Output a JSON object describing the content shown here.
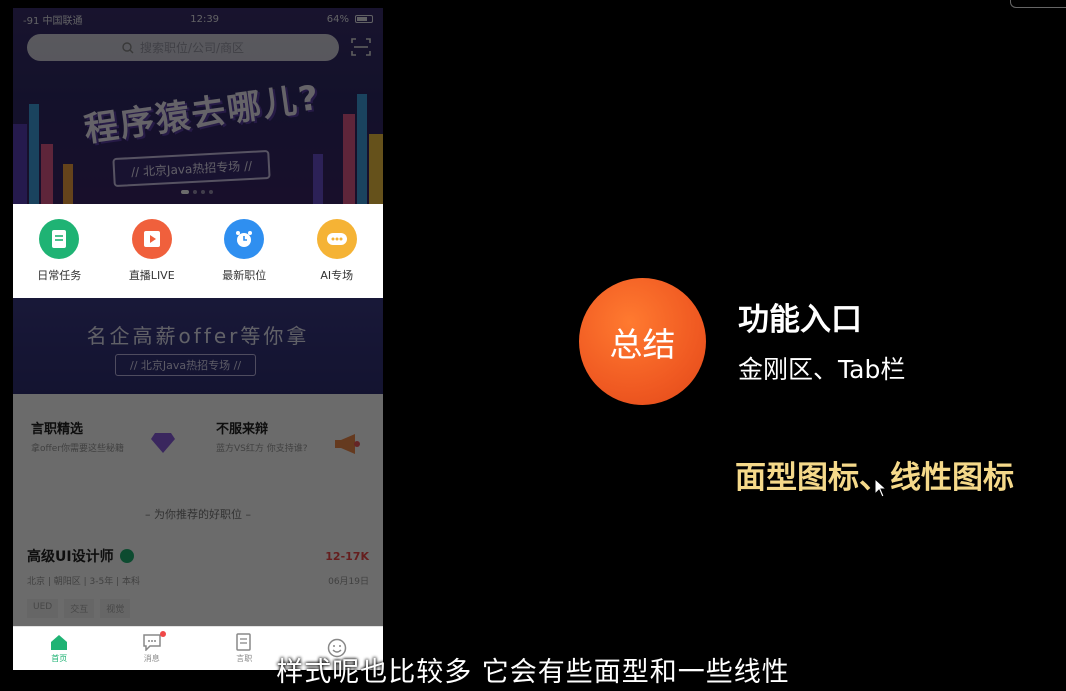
{
  "status_bar": {
    "carrier": "-91 中国联通",
    "time": "12:39",
    "battery": "64%"
  },
  "search": {
    "placeholder": "搜索职位/公司/商区"
  },
  "banner": {
    "title": "程序猿去哪儿?",
    "subtitle": "// 北京Java热招专场 //"
  },
  "kingkong": [
    {
      "label": "日常任务",
      "color": "#1fb374",
      "icon": "document-icon"
    },
    {
      "label": "直播LIVE",
      "color": "#f0603c",
      "icon": "play-icon"
    },
    {
      "label": "最新职位",
      "color": "#2f8ff0",
      "icon": "clock-icon"
    },
    {
      "label": "AI专场",
      "color": "#f5b335",
      "icon": "chat-icon"
    }
  ],
  "promo": {
    "title": "名企高薪offer等你拿",
    "subtitle": "// 北京Java热招专场 //"
  },
  "cards": [
    {
      "title": "言职精选",
      "desc": "拿offer你需要这些秘籍",
      "icon": "diamond-icon"
    },
    {
      "title": "不服来辩",
      "desc": "蓝方VS红方 你支持谁?",
      "icon": "megaphone-icon"
    }
  ],
  "recommend_title": "– 为你推荐的好职位 –",
  "job": {
    "name": "高级UI设计师",
    "salary": "12-17K",
    "meta": "北京 | 朝阳区 | 3-5年 | 本科",
    "date": "06月19日",
    "tags": [
      "UED",
      "交互",
      "视觉"
    ]
  },
  "tabs": [
    {
      "label": "首页",
      "icon": "home-icon",
      "active": true
    },
    {
      "label": "消息",
      "icon": "message-icon",
      "active": false
    },
    {
      "label": "言职",
      "icon": "document-icon",
      "active": false
    },
    {
      "label": "",
      "icon": "smile-icon",
      "active": false
    }
  ],
  "summary": {
    "badge": "总结",
    "title": "功能入口",
    "subtitle": "金刚区、Tab栏",
    "highlight": "面型图标、线性图标"
  },
  "caption": "样式呢也比较多 它会有些面型和一些线性",
  "colors": {
    "accent_orange": "#f05a22",
    "highlight_yellow": "#f5d98a",
    "brand_green": "#1fb374"
  }
}
